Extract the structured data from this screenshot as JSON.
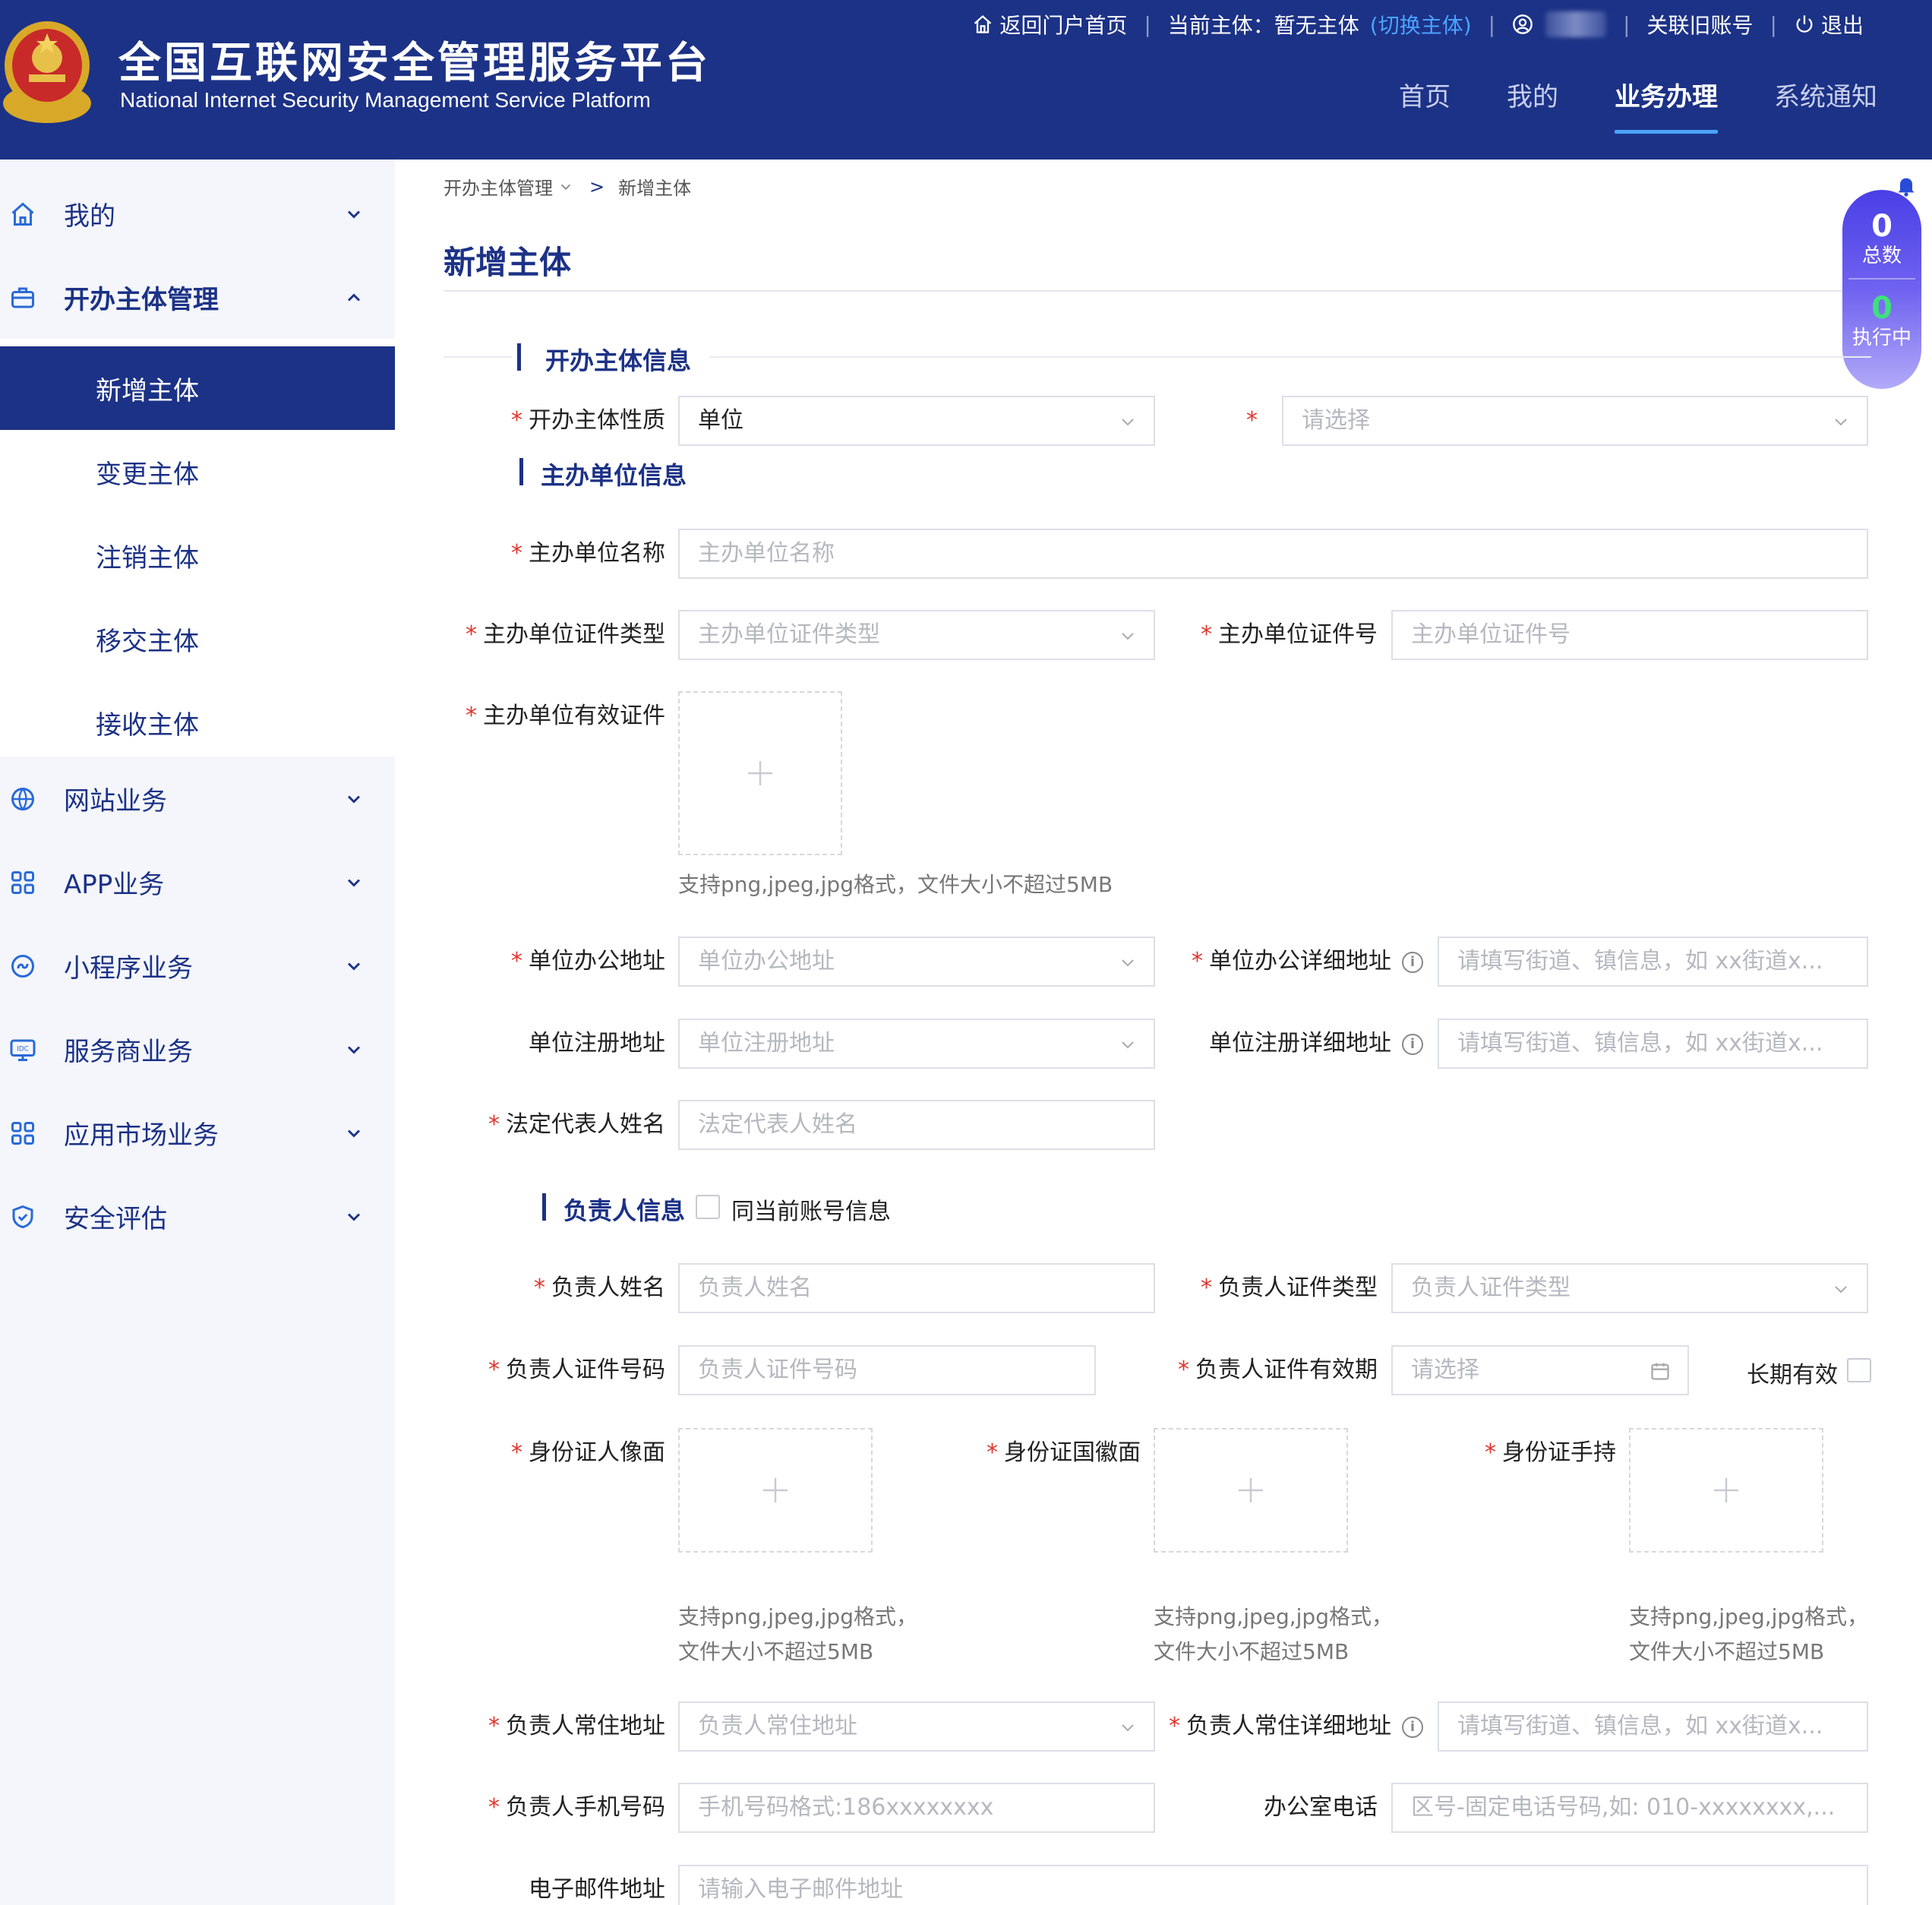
{
  "header": {
    "title_cn": "全国互联网安全管理服务平台",
    "title_en": "National Internet Security Management Service Platform",
    "top_links": {
      "home": "返回门户首页",
      "current_entity_label": "当前主体：暂无主体",
      "switch_entity": "(切换主体)",
      "link_old_account": "关联旧账号",
      "logout": "退出"
    },
    "nav": [
      "首页",
      "我的",
      "业务办理",
      "系统通知"
    ],
    "active_nav": "业务办理"
  },
  "sidebar": {
    "items": [
      {
        "label": "我的",
        "icon": "home-icon",
        "expanded": false
      },
      {
        "label": "开办主体管理",
        "icon": "briefcase-icon",
        "expanded": true
      },
      {
        "label": "网站业务",
        "icon": "globe-icon",
        "expanded": false
      },
      {
        "label": "APP业务",
        "icon": "apps-grid-icon",
        "expanded": false
      },
      {
        "label": "小程序业务",
        "icon": "miniprogram-icon",
        "expanded": false
      },
      {
        "label": "服务商业务",
        "icon": "idc-monitor-icon",
        "expanded": false
      },
      {
        "label": "应用市场业务",
        "icon": "apps-grid-icon",
        "expanded": false
      },
      {
        "label": "安全评估",
        "icon": "shield-icon",
        "expanded": false
      }
    ],
    "sub_items": [
      "新增主体",
      "变更主体",
      "注销主体",
      "移交主体",
      "接收主体"
    ],
    "active_sub": "新增主体"
  },
  "breadcrumb": {
    "parent": "开办主体管理",
    "separator": ">",
    "current": "新增主体"
  },
  "page_title": "新增主体",
  "floating_widget": {
    "total_count": "0",
    "total_label": "总数",
    "running_count": "0",
    "running_label": "执行中"
  },
  "form": {
    "section_entity": "开办主体信息",
    "entity_nature": {
      "label": "开办主体性质",
      "value": "单位"
    },
    "entity_type": {
      "label": "",
      "placeholder": "请选择"
    },
    "section_org": "主办单位信息",
    "org_name": {
      "label": "主办单位名称",
      "placeholder": "主办单位名称"
    },
    "org_cert_type": {
      "label": "主办单位证件类型",
      "placeholder": "主办单位证件类型"
    },
    "org_cert_no": {
      "label": "主办单位证件号",
      "placeholder": "主办单位证件号"
    },
    "org_cert_upload": {
      "label": "主办单位有效证件",
      "hint": "支持png,jpeg,jpg格式，文件大小不超过5MB"
    },
    "office_addr": {
      "label": "单位办公地址",
      "placeholder": "单位办公地址"
    },
    "office_addr_detail": {
      "label": "单位办公详细地址",
      "placeholder": "请填写街道、镇信息，如 xx街道x..."
    },
    "reg_addr": {
      "label": "单位注册地址",
      "placeholder": "单位注册地址"
    },
    "reg_addr_detail": {
      "label": "单位注册详细地址",
      "placeholder": "请填写街道、镇信息，如 xx街道x..."
    },
    "legal_rep": {
      "label": "法定代表人姓名",
      "placeholder": "法定代表人姓名"
    },
    "section_person": "负责人信息",
    "same_as_account": "同当前账号信息",
    "person_name": {
      "label": "负责人姓名",
      "placeholder": "负责人姓名"
    },
    "person_cert_type": {
      "label": "负责人证件类型",
      "placeholder": "负责人证件类型"
    },
    "person_cert_no": {
      "label": "负责人证件号码",
      "placeholder": "负责人证件号码"
    },
    "person_cert_validity": {
      "label": "负责人证件有效期",
      "placeholder": "请选择"
    },
    "long_term": "长期有效",
    "id_front": {
      "label": "身份证人像面",
      "hint1": "支持png,jpeg,jpg格式，",
      "hint2": "文件大小不超过5MB"
    },
    "id_back": {
      "label": "身份证国徽面",
      "hint1": "支持png,jpeg,jpg格式，",
      "hint2": "文件大小不超过5MB"
    },
    "id_hand": {
      "label": "身份证手持",
      "hint1": "支持png,jpeg,jpg格式，",
      "hint2": "文件大小不超过5MB"
    },
    "person_addr": {
      "label": "负责人常住地址",
      "placeholder": "负责人常住地址"
    },
    "person_addr_detail": {
      "label": "负责人常住详细地址",
      "placeholder": "请填写街道、镇信息，如 xx街道x..."
    },
    "person_phone": {
      "label": "负责人手机号码",
      "placeholder": "手机号码格式:186xxxxxxxx"
    },
    "office_phone": {
      "label": "办公室电话",
      "placeholder": "区号-固定电话号码,如: 010-xxxxxxxx,..."
    },
    "email": {
      "label": "电子邮件地址",
      "placeholder": "请输入电子邮件地址"
    }
  },
  "colors": {
    "brand": "#1c3286",
    "required": "#e0342c",
    "accent": "#4aa3ff"
  }
}
